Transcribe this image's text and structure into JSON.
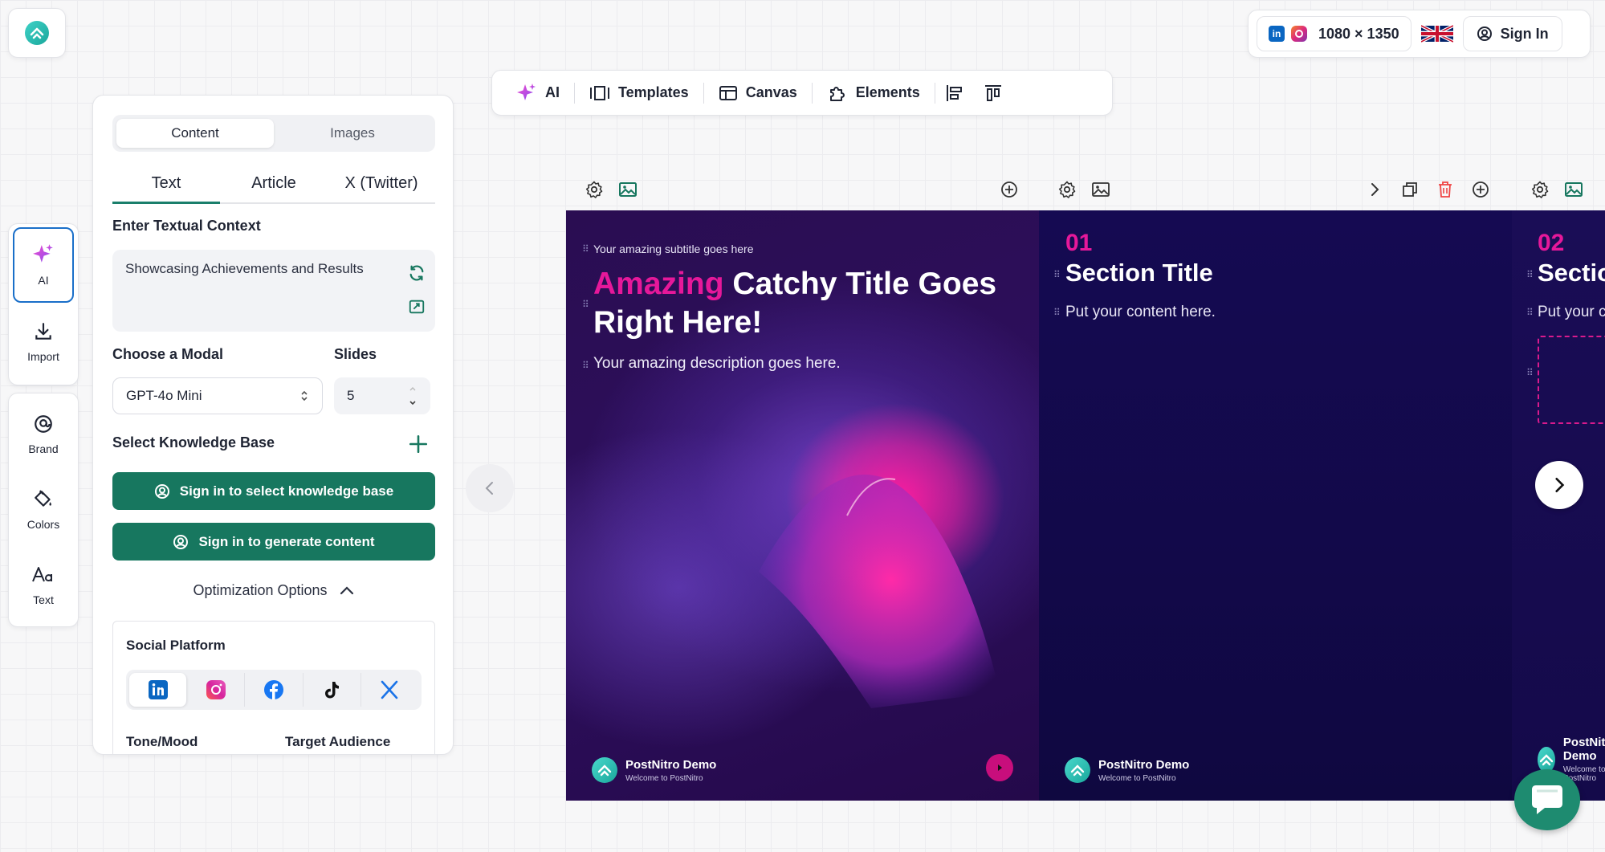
{
  "top_right": {
    "size_label": "1080 × 1350",
    "signin_label": "Sign In",
    "linkedin_glyph": "in"
  },
  "toolbar": {
    "items": [
      {
        "label": "AI",
        "icon": "sparkle-icon"
      },
      {
        "label": "Templates",
        "icon": "templates-icon"
      },
      {
        "label": "Canvas",
        "icon": "canvas-icon"
      },
      {
        "label": "Elements",
        "icon": "puzzle-icon"
      }
    ]
  },
  "rail": {
    "items": [
      {
        "label": "AI"
      },
      {
        "label": "Import"
      },
      {
        "label": "Brand"
      },
      {
        "label": "Colors"
      },
      {
        "label": "Text"
      }
    ]
  },
  "panel": {
    "seg_tabs": [
      "Content",
      "Images"
    ],
    "sub_tabs": [
      "Text",
      "Article",
      "X (Twitter)"
    ],
    "context_label": "Enter Textual Context",
    "context_value": "Showcasing Achievements and Results",
    "model_label": "Choose a Modal",
    "model_value": "GPT-4o Mini",
    "slides_label": "Slides",
    "slides_value": "5",
    "kb_label": "Select Knowledge Base",
    "btn_kb": "Sign in to select knowledge base",
    "btn_generate": "Sign in to generate content",
    "optimization_label": "Optimization Options",
    "social_label": "Social Platform",
    "tone_label": "Tone/Mood",
    "audience_label": "Target Audience"
  },
  "slides": {
    "s1": {
      "subtitle": "Your amazing subtitle goes here",
      "title_highlight": "Amazing",
      "title_rest": " Catchy Title Goes Right Here!",
      "description": "Your amazing description goes here.",
      "brand_name": "PostNitro Demo",
      "brand_tag": "Welcome to PostNitro"
    },
    "s2": {
      "number": "01",
      "title": "Section Title",
      "body": "Put your content here.",
      "brand_name": "PostNitro Demo",
      "brand_tag": "Welcome to PostNitro"
    },
    "s3": {
      "number": "02",
      "title": "Section Title",
      "body": "Put your content here.",
      "brand_name": "PostNitro Demo",
      "brand_tag": "Welcome to PostNitro"
    }
  },
  "colors": {
    "accent_green": "#17775f",
    "accent_pink": "#e6189a",
    "slide_bg": "#150a52"
  }
}
